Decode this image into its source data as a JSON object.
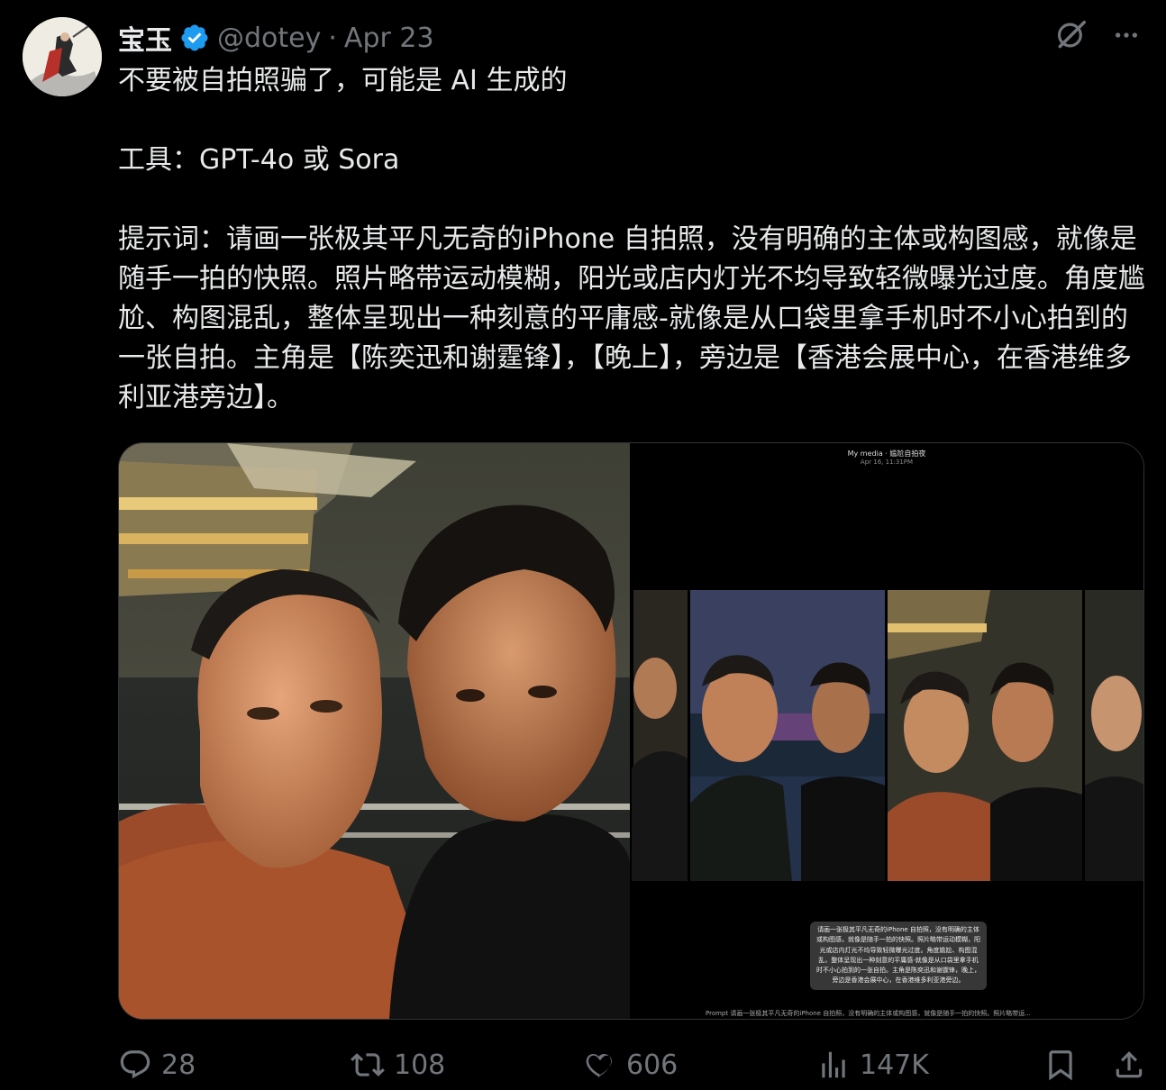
{
  "colors": {
    "background": "#000000",
    "text": "#e7e9ea",
    "muted": "#71767b",
    "verified": "#1d9bf0"
  },
  "author": {
    "display_name": "宝玉",
    "handle": "@dotey",
    "separator": "·",
    "date": "Apr 23",
    "avatar_icon": "avatar-image",
    "verified_icon": "verified-badge-icon"
  },
  "top_actions": {
    "grok_icon": "grok-icon",
    "more_icon": "more-icon"
  },
  "tweet": {
    "text": "不要被自拍照骗了，可能是 AI 生成的\n\n工具：GPT-4o 或 Sora\n\n提示词：请画一张极其平凡无奇的iPhone 自拍照，没有明确的主体或构图感，就像是随手一拍的快照。照片略带运动模糊，阳光或店内灯光不均导致轻微曝光过度。角度尴尬、构图混乱，整体呈现出一种刻意的平庸感-就像是从口袋里拿手机时不小心拍到的一张自拍。主角是【陈奕迅和谢霆锋】，【晚上】，旁边是【香港会展中心，在香港维多利亚港旁边】。"
  },
  "media": {
    "right_header": "My media · 尴尬自拍夜",
    "right_subheader": "Apr 16, 11:31PM",
    "right_caption": "请画一张极其平凡无奇的iPhone 自拍照，没有明确的主体或构图感，就像是随手一拍的快照。照片略带运动模糊，阳光或店内灯光不均导致轻微曝光过度。角度尴尬、构图混乱，整体呈现出一种刻意的平庸感-就像是从口袋里拿手机时不小心拍到的一张自拍。主角是陈奕迅和谢霆锋，晚上，旁边是香港会展中心，在香港维多利亚港旁边。",
    "right_prompt": "Prompt  请画一张极其平凡无奇的iPhone 自拍照，没有明确的主体或构图感，就像是随手一拍的快照。照片略带运..."
  },
  "actions": {
    "reply": {
      "icon": "reply-icon",
      "count": "28"
    },
    "retweet": {
      "icon": "retweet-icon",
      "count": "108"
    },
    "like": {
      "icon": "like-icon",
      "count": "606"
    },
    "views": {
      "icon": "views-icon",
      "count": "147K"
    },
    "bookmark": {
      "icon": "bookmark-icon"
    },
    "share": {
      "icon": "share-icon"
    }
  }
}
